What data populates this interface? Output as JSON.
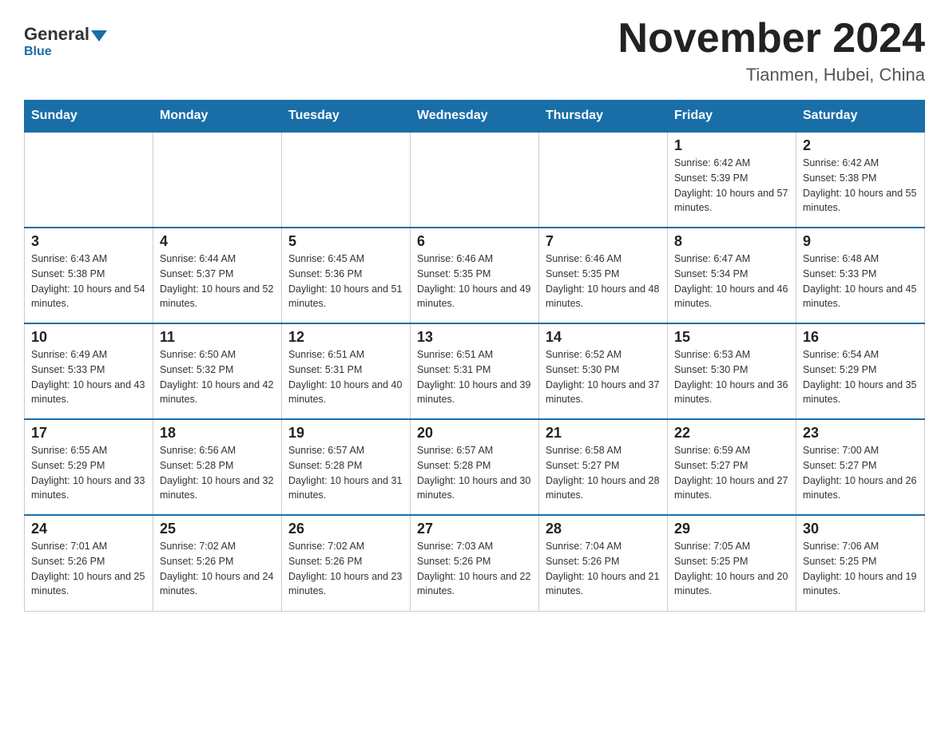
{
  "header": {
    "logo_general": "General",
    "logo_blue": "Blue",
    "title": "November 2024",
    "subtitle": "Tianmen, Hubei, China"
  },
  "days_of_week": [
    "Sunday",
    "Monday",
    "Tuesday",
    "Wednesday",
    "Thursday",
    "Friday",
    "Saturday"
  ],
  "weeks": [
    [
      {
        "day": "",
        "info": ""
      },
      {
        "day": "",
        "info": ""
      },
      {
        "day": "",
        "info": ""
      },
      {
        "day": "",
        "info": ""
      },
      {
        "day": "",
        "info": ""
      },
      {
        "day": "1",
        "info": "Sunrise: 6:42 AM\nSunset: 5:39 PM\nDaylight: 10 hours and 57 minutes."
      },
      {
        "day": "2",
        "info": "Sunrise: 6:42 AM\nSunset: 5:38 PM\nDaylight: 10 hours and 55 minutes."
      }
    ],
    [
      {
        "day": "3",
        "info": "Sunrise: 6:43 AM\nSunset: 5:38 PM\nDaylight: 10 hours and 54 minutes."
      },
      {
        "day": "4",
        "info": "Sunrise: 6:44 AM\nSunset: 5:37 PM\nDaylight: 10 hours and 52 minutes."
      },
      {
        "day": "5",
        "info": "Sunrise: 6:45 AM\nSunset: 5:36 PM\nDaylight: 10 hours and 51 minutes."
      },
      {
        "day": "6",
        "info": "Sunrise: 6:46 AM\nSunset: 5:35 PM\nDaylight: 10 hours and 49 minutes."
      },
      {
        "day": "7",
        "info": "Sunrise: 6:46 AM\nSunset: 5:35 PM\nDaylight: 10 hours and 48 minutes."
      },
      {
        "day": "8",
        "info": "Sunrise: 6:47 AM\nSunset: 5:34 PM\nDaylight: 10 hours and 46 minutes."
      },
      {
        "day": "9",
        "info": "Sunrise: 6:48 AM\nSunset: 5:33 PM\nDaylight: 10 hours and 45 minutes."
      }
    ],
    [
      {
        "day": "10",
        "info": "Sunrise: 6:49 AM\nSunset: 5:33 PM\nDaylight: 10 hours and 43 minutes."
      },
      {
        "day": "11",
        "info": "Sunrise: 6:50 AM\nSunset: 5:32 PM\nDaylight: 10 hours and 42 minutes."
      },
      {
        "day": "12",
        "info": "Sunrise: 6:51 AM\nSunset: 5:31 PM\nDaylight: 10 hours and 40 minutes."
      },
      {
        "day": "13",
        "info": "Sunrise: 6:51 AM\nSunset: 5:31 PM\nDaylight: 10 hours and 39 minutes."
      },
      {
        "day": "14",
        "info": "Sunrise: 6:52 AM\nSunset: 5:30 PM\nDaylight: 10 hours and 37 minutes."
      },
      {
        "day": "15",
        "info": "Sunrise: 6:53 AM\nSunset: 5:30 PM\nDaylight: 10 hours and 36 minutes."
      },
      {
        "day": "16",
        "info": "Sunrise: 6:54 AM\nSunset: 5:29 PM\nDaylight: 10 hours and 35 minutes."
      }
    ],
    [
      {
        "day": "17",
        "info": "Sunrise: 6:55 AM\nSunset: 5:29 PM\nDaylight: 10 hours and 33 minutes."
      },
      {
        "day": "18",
        "info": "Sunrise: 6:56 AM\nSunset: 5:28 PM\nDaylight: 10 hours and 32 minutes."
      },
      {
        "day": "19",
        "info": "Sunrise: 6:57 AM\nSunset: 5:28 PM\nDaylight: 10 hours and 31 minutes."
      },
      {
        "day": "20",
        "info": "Sunrise: 6:57 AM\nSunset: 5:28 PM\nDaylight: 10 hours and 30 minutes."
      },
      {
        "day": "21",
        "info": "Sunrise: 6:58 AM\nSunset: 5:27 PM\nDaylight: 10 hours and 28 minutes."
      },
      {
        "day": "22",
        "info": "Sunrise: 6:59 AM\nSunset: 5:27 PM\nDaylight: 10 hours and 27 minutes."
      },
      {
        "day": "23",
        "info": "Sunrise: 7:00 AM\nSunset: 5:27 PM\nDaylight: 10 hours and 26 minutes."
      }
    ],
    [
      {
        "day": "24",
        "info": "Sunrise: 7:01 AM\nSunset: 5:26 PM\nDaylight: 10 hours and 25 minutes."
      },
      {
        "day": "25",
        "info": "Sunrise: 7:02 AM\nSunset: 5:26 PM\nDaylight: 10 hours and 24 minutes."
      },
      {
        "day": "26",
        "info": "Sunrise: 7:02 AM\nSunset: 5:26 PM\nDaylight: 10 hours and 23 minutes."
      },
      {
        "day": "27",
        "info": "Sunrise: 7:03 AM\nSunset: 5:26 PM\nDaylight: 10 hours and 22 minutes."
      },
      {
        "day": "28",
        "info": "Sunrise: 7:04 AM\nSunset: 5:26 PM\nDaylight: 10 hours and 21 minutes."
      },
      {
        "day": "29",
        "info": "Sunrise: 7:05 AM\nSunset: 5:25 PM\nDaylight: 10 hours and 20 minutes."
      },
      {
        "day": "30",
        "info": "Sunrise: 7:06 AM\nSunset: 5:25 PM\nDaylight: 10 hours and 19 minutes."
      }
    ]
  ]
}
